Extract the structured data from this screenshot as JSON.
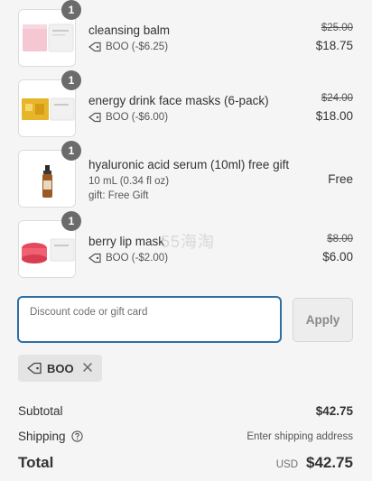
{
  "items": [
    {
      "quantity": "1",
      "title": "cleansing balm",
      "discount_label": "BOO (-$6.25)",
      "original_price": "$25.00",
      "price": "$18.75"
    },
    {
      "quantity": "1",
      "title": "energy drink face masks (6-pack)",
      "discount_label": "BOO (-$6.00)",
      "original_price": "$24.00",
      "price": "$18.00"
    },
    {
      "quantity": "1",
      "title": "hyaluronic acid serum (10ml) free gift",
      "variant": "10 mL (0.34 fl oz)",
      "gift_line": "gift: Free Gift",
      "price": "Free"
    },
    {
      "quantity": "1",
      "title": "berry lip mask",
      "discount_label": "BOO (-$2.00)",
      "original_price": "$8.00",
      "price": "$6.00"
    }
  ],
  "discount": {
    "placeholder": "Discount code or gift card",
    "apply_label": "Apply",
    "applied_code": "BOO"
  },
  "summary": {
    "subtotal_label": "Subtotal",
    "subtotal_value": "$42.75",
    "shipping_label": "Shipping",
    "shipping_value": "Enter shipping address",
    "total_label": "Total",
    "currency": "USD",
    "total_value": "$42.75"
  },
  "watermark": "55海淘",
  "colors": {
    "background": "#f5f5f5",
    "input_border": "#2f6fa3",
    "badge": "#6b6b6b",
    "chip": "#e4e4e4"
  }
}
